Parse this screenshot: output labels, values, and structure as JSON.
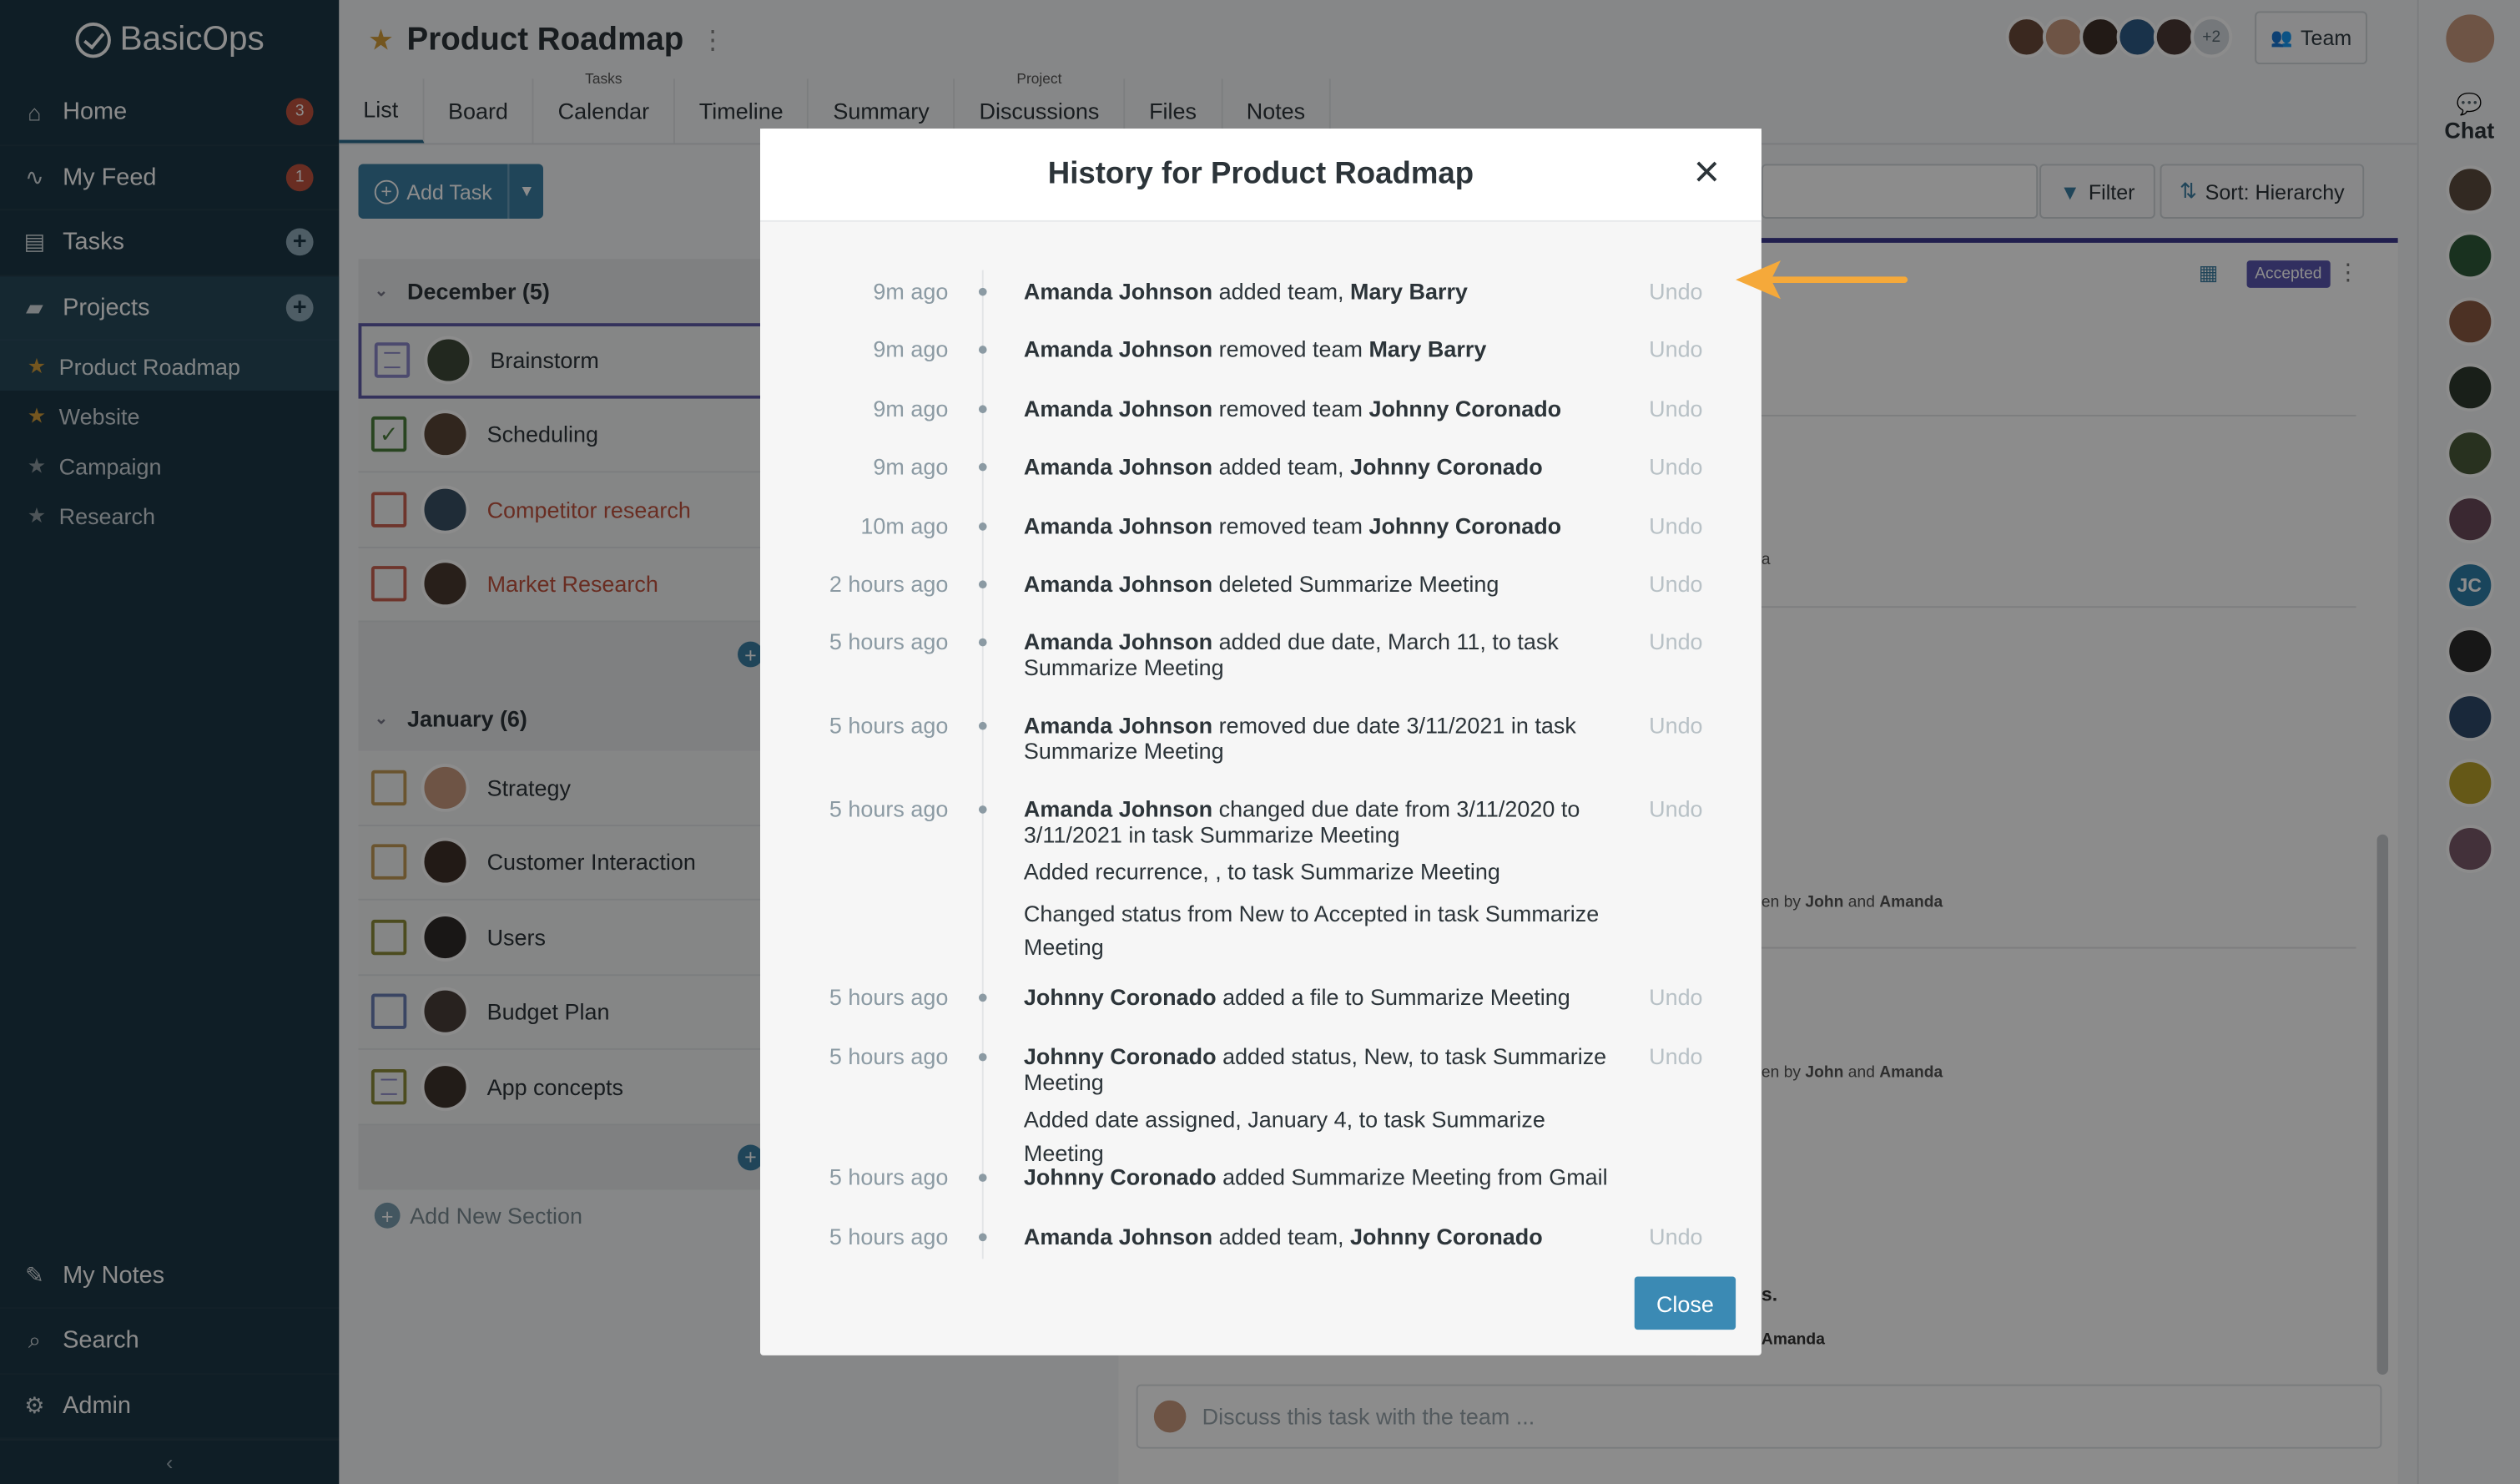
{
  "brand": "BasicOps",
  "sidebar": {
    "items": [
      {
        "label": "Home",
        "icon": "home-icon",
        "badge": "3"
      },
      {
        "label": "My Feed",
        "icon": "activity-icon",
        "badge": "1"
      },
      {
        "label": "Tasks",
        "icon": "clipboard-icon"
      },
      {
        "label": "Projects",
        "icon": "folder-icon"
      }
    ],
    "projects": [
      "Product Roadmap",
      "Website",
      "Campaign",
      "Research"
    ],
    "bottom": [
      "My Notes",
      "Search",
      "Admin"
    ],
    "collapse": "‹"
  },
  "header": {
    "title": "Product Roadmap",
    "more_avatars": "+2",
    "team_label": "Team"
  },
  "tabs": [
    {
      "label": "List",
      "cap": ""
    },
    {
      "label": "Board",
      "cap": ""
    },
    {
      "label": "Calendar",
      "cap": "Tasks"
    },
    {
      "label": "Timeline",
      "cap": ""
    },
    {
      "label": "Summary",
      "cap": ""
    },
    {
      "label": "Discussions",
      "cap": "Project"
    },
    {
      "label": "Files",
      "cap": ""
    },
    {
      "label": "Notes",
      "cap": ""
    }
  ],
  "toolbar": {
    "add_task": "Add Task",
    "filter": "Filter",
    "sort": "Sort: Hierarchy"
  },
  "sections": [
    {
      "title": "December (5)",
      "tasks": [
        "Brainstorm",
        "Scheduling",
        "Competitor research",
        "Market Research"
      ]
    },
    {
      "title": "January (6)",
      "tasks": [
        "Strategy",
        "Customer Interaction",
        "Users",
        "Budget Plan",
        "App concepts"
      ]
    }
  ],
  "add_section": "Add New Section",
  "detail": {
    "accepted": "Accepted",
    "discuss_placeholder": "Discuss this task with the team ...",
    "fragments": [
      "a",
      "en by",
      "John",
      "and",
      "Amanda",
      "s.",
      "Amanda"
    ]
  },
  "rail": {
    "chat": "Chat",
    "initials": "JC"
  },
  "modal": {
    "title": "History for Product Roadmap",
    "close": "Close",
    "undo": "Undo",
    "entries": [
      {
        "time": "9m ago",
        "actor": "Amanda Johnson",
        "action": " added team, ",
        "target": "Mary Barry",
        "undo": true
      },
      {
        "time": "9m ago",
        "actor": "Amanda Johnson",
        "action": " removed team ",
        "target": "Mary Barry",
        "undo": true
      },
      {
        "time": "9m ago",
        "actor": "Amanda Johnson",
        "action": " removed team ",
        "target": "Johnny Coronado",
        "undo": true
      },
      {
        "time": "9m ago",
        "actor": "Amanda Johnson",
        "action": " added team, ",
        "target": "Johnny Coronado",
        "undo": true
      },
      {
        "time": "10m ago",
        "actor": "Amanda Johnson",
        "action": " removed team ",
        "target": "Johnny Coronado",
        "undo": true
      },
      {
        "time": "2 hours ago",
        "actor": "Amanda Johnson",
        "action": " deleted Summarize Meeting",
        "target": "",
        "undo": true
      },
      {
        "time": "5 hours ago",
        "actor": "Amanda Johnson",
        "action": " added due date, March 11, to task Summarize Meeting",
        "target": "",
        "undo": true
      },
      {
        "time": "5 hours ago",
        "actor": "Amanda Johnson",
        "action": " removed due date 3/11/2021 in task Summarize Meeting",
        "target": "",
        "undo": true
      },
      {
        "time": "5 hours ago",
        "actor": "Amanda Johnson",
        "action": " changed due date from 3/11/2020 to 3/11/2021 in task Summarize Meeting",
        "target": "",
        "undo": true,
        "extra": [
          "Added recurrence, , to task Summarize Meeting",
          "Changed status from New to Accepted in task Summarize Meeting"
        ]
      },
      {
        "time": "5 hours ago",
        "actor": "Johnny Coronado",
        "action": " added a file to Summarize Meeting",
        "target": "",
        "undo": true
      },
      {
        "time": "5 hours ago",
        "actor": "Johnny Coronado",
        "action": " added status, New, to task Summarize Meeting",
        "target": "",
        "undo": true,
        "extra": [
          "Added date assigned, January 4, to task Summarize Meeting"
        ]
      },
      {
        "time": "5 hours ago",
        "actor": "Johnny Coronado",
        "action": " added Summarize Meeting from Gmail",
        "target": "",
        "undo": false
      },
      {
        "time": "5 hours ago",
        "actor": "Amanda Johnson",
        "action": " added team, ",
        "target": "Johnny Coronado",
        "undo": true
      }
    ]
  },
  "colors": {
    "sidebar": "#1d3745",
    "accent": "#3b7ea3",
    "arrow": "#f5a93a",
    "badge": "#c0533f"
  }
}
